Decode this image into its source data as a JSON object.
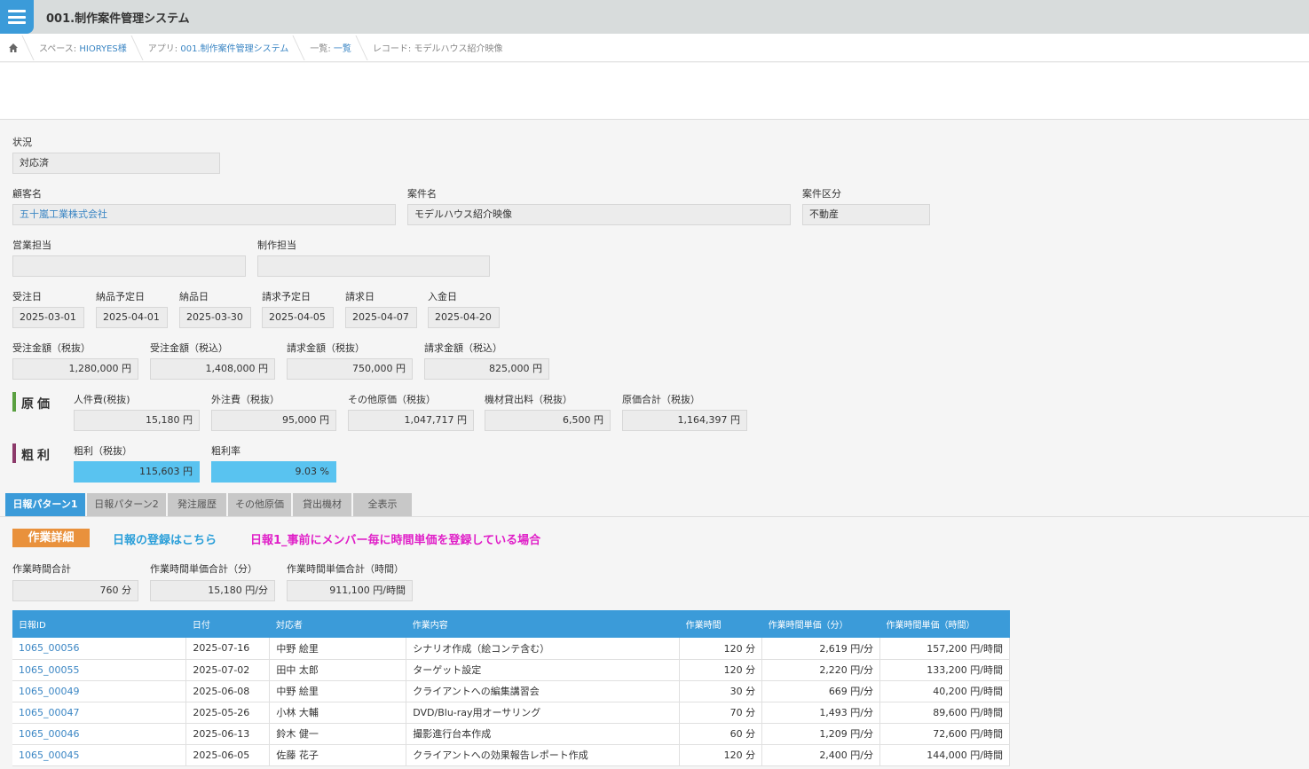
{
  "app": {
    "title": "001.制作案件管理システム"
  },
  "breadcrumb": {
    "space_label": "スペース:",
    "space_value": "HIORYES様",
    "app_label": "アプリ:",
    "app_value": "001.制作案件管理システム",
    "view_label": "一覧:",
    "view_value": "一覧",
    "record_label": "レコード:",
    "record_value": "モデルハウス紹介映像"
  },
  "fields": {
    "status": {
      "label": "状況",
      "value": "対応済"
    },
    "customer": {
      "label": "顧客名",
      "value": "五十嵐工業株式会社"
    },
    "project": {
      "label": "案件名",
      "value": "モデルハウス紹介映像"
    },
    "category": {
      "label": "案件区分",
      "value": "不動産"
    },
    "sales": {
      "label": "営業担当",
      "value": ""
    },
    "producer": {
      "label": "制作担当",
      "value": ""
    },
    "order_date": {
      "label": "受注日",
      "value": "2025-03-01"
    },
    "delivery_plan": {
      "label": "納品予定日",
      "value": "2025-04-01"
    },
    "delivery_date": {
      "label": "納品日",
      "value": "2025-03-30"
    },
    "invoice_plan": {
      "label": "請求予定日",
      "value": "2025-04-05"
    },
    "invoice_date": {
      "label": "請求日",
      "value": "2025-04-07"
    },
    "payment_date": {
      "label": "入金日",
      "value": "2025-04-20"
    },
    "order_amount_ex": {
      "label": "受注金額（税抜）",
      "value": "1,280,000 円"
    },
    "order_amount_in": {
      "label": "受注金額（税込）",
      "value": "1,408,000 円"
    },
    "invoice_amount_ex": {
      "label": "請求金額（税抜）",
      "value": "750,000 円"
    },
    "invoice_amount_in": {
      "label": "請求金額（税込）",
      "value": "825,000 円"
    }
  },
  "cost": {
    "heading": "原価",
    "labor": {
      "label": "人件費(税抜)",
      "value": "15,180 円"
    },
    "outsource": {
      "label": "外注費（税抜）",
      "value": "95,000 円"
    },
    "other": {
      "label": "その他原価（税抜）",
      "value": "1,047,717 円"
    },
    "equipment": {
      "label": "機材貸出料（税抜）",
      "value": "6,500 円"
    },
    "total": {
      "label": "原価合計（税抜）",
      "value": "1,164,397 円"
    }
  },
  "profit": {
    "heading": "粗利",
    "gross": {
      "label": "粗利（税抜）",
      "value": "115,603 円"
    },
    "rate": {
      "label": "粗利率",
      "value": "9.03 %"
    }
  },
  "tabs": [
    "日報パターン1",
    "日報パターン2",
    "発注履歴",
    "その他原価",
    "貸出機材",
    "全表示"
  ],
  "work": {
    "badge": "作業詳細",
    "link": "日報の登録はこちら",
    "note": "日報1_事前にメンバー毎に時間単価を登録している場合",
    "total_time": {
      "label": "作業時間合計",
      "value": "760 分"
    },
    "unit_min": {
      "label": "作業時間単価合計（分）",
      "value": "15,180 円/分"
    },
    "unit_hour": {
      "label": "作業時間単価合計（時間）",
      "value": "911,100 円/時間"
    }
  },
  "table": {
    "headers": [
      "日報ID",
      "日付",
      "対応者",
      "作業内容",
      "作業時間",
      "作業時間単価（分）",
      "作業時間単価（時間）"
    ],
    "rows": [
      [
        "1065_00056",
        "2025-07-16",
        "中野 絵里",
        "シナリオ作成（絵コンテ含む）",
        "120 分",
        "2,619 円/分",
        "157,200 円/時間"
      ],
      [
        "1065_00055",
        "2025-07-02",
        "田中 太郎",
        "ターゲット設定",
        "120 分",
        "2,220 円/分",
        "133,200 円/時間"
      ],
      [
        "1065_00049",
        "2025-06-08",
        "中野 絵里",
        "クライアントへの編集講習会",
        "30 分",
        "669 円/分",
        "40,200 円/時間"
      ],
      [
        "1065_00047",
        "2025-05-26",
        "小林 大輔",
        "DVD/Blu-ray用オーサリング",
        "70 分",
        "1,493 円/分",
        "89,600 円/時間"
      ],
      [
        "1065_00046",
        "2025-06-13",
        "鈴木 健一",
        "撮影進行台本作成",
        "60 分",
        "1,209 円/分",
        "72,600 円/時間"
      ],
      [
        "1065_00045",
        "2025-06-05",
        "佐藤 花子",
        "クライアントへの効果報告レポート作成",
        "120 分",
        "2,400 円/分",
        "144,000 円/時間"
      ]
    ]
  },
  "colors": {
    "accent": "#3b9bd9",
    "badge": "#e9913c",
    "highlight": "#59c3f0",
    "note": "#e020c8"
  }
}
